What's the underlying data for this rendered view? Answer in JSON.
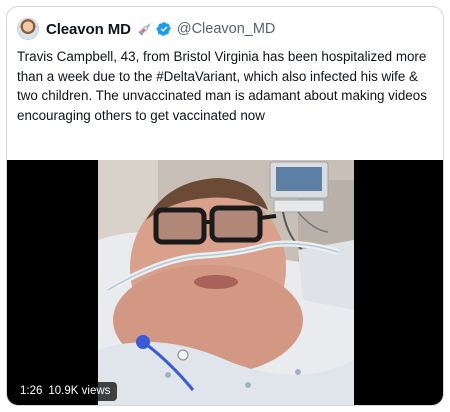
{
  "tweet": {
    "display_name": "Cleavon MD",
    "name_emoji_icon": "syringe-icon",
    "verified": true,
    "handle": "@Cleavon_MD",
    "text": "Travis Campbell, 43, from Bristol Virginia has been hospitalized more\nthan a week due to the #DeltaVariant, which also infected his wife &\ntwo children. The unvaccinated man is adamant about making videos\nencouraging others to get vaccinated now"
  },
  "video": {
    "duration": "1:26",
    "views": "10.9K views"
  },
  "colors": {
    "verified_blue": "#1d9bf0",
    "handle_gray": "#536471",
    "border": "#cfd9de"
  }
}
